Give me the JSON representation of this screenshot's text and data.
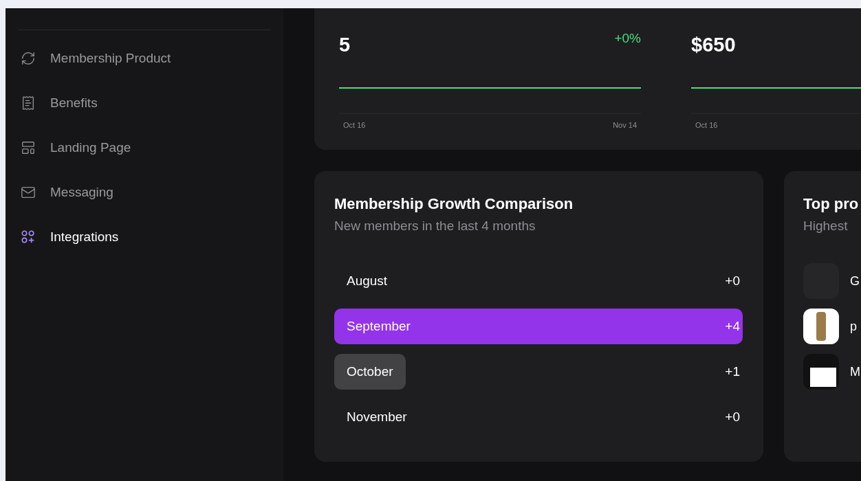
{
  "sidebar": {
    "items": [
      {
        "label": "Membership Product",
        "selected": false
      },
      {
        "label": "Benefits",
        "selected": false
      },
      {
        "label": "Landing Page",
        "selected": false
      },
      {
        "label": "Messaging",
        "selected": false
      },
      {
        "label": "Integrations",
        "selected": true
      }
    ]
  },
  "stats": [
    {
      "value": "5",
      "change": "+0%",
      "start_date": "Oct 16",
      "end_date": "Nov 14"
    },
    {
      "value": "$650",
      "start_date": "Oct 16"
    }
  ],
  "growth": {
    "title": "Membership Growth Comparison",
    "subtitle": "New members in the last 4 months",
    "rows": [
      {
        "month": "August",
        "delta": "+0",
        "selected": false,
        "hovered": false
      },
      {
        "month": "September",
        "delta": "+4",
        "selected": true,
        "hovered": false
      },
      {
        "month": "October",
        "delta": "+1",
        "selected": false,
        "hovered": true
      },
      {
        "month": "November",
        "delta": "+0",
        "selected": false,
        "hovered": false
      }
    ]
  },
  "top_products": {
    "title": "Top pro",
    "subtitle": "Highest",
    "items": [
      {
        "name": "G"
      },
      {
        "name": "p"
      },
      {
        "name": "M"
      }
    ]
  }
}
